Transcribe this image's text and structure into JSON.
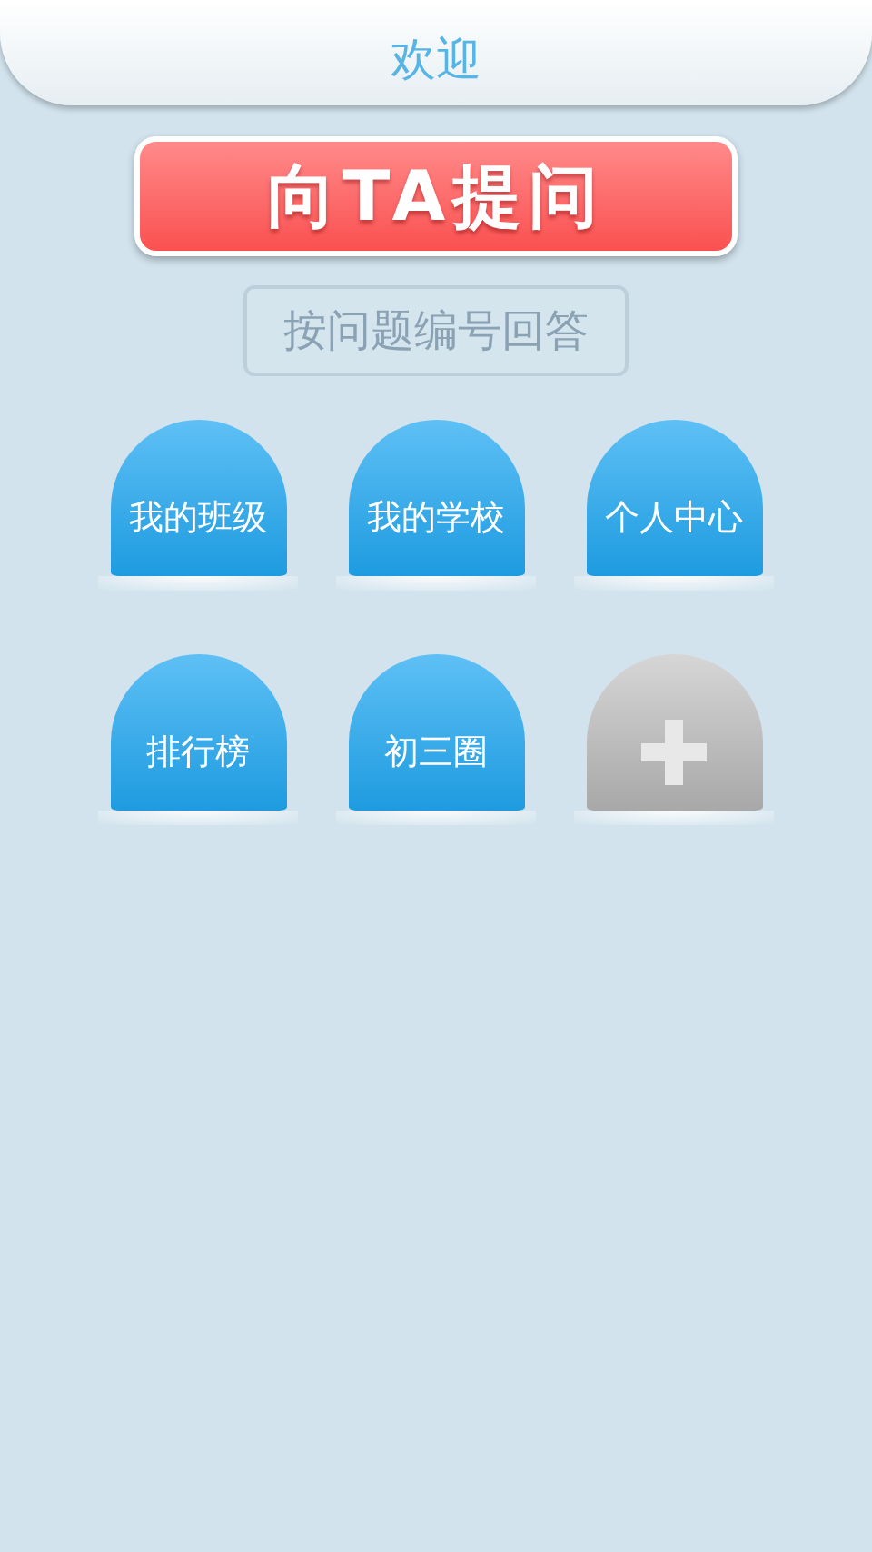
{
  "header": {
    "title": "欢迎"
  },
  "ask_button": {
    "label": "向TA提问"
  },
  "answer_button": {
    "label": "按问题编号回答"
  },
  "tiles": [
    {
      "kind": "label",
      "label": "我的班级"
    },
    {
      "kind": "label",
      "label": "我的学校"
    },
    {
      "kind": "label",
      "label": "个人中心"
    },
    {
      "kind": "label",
      "label": "排行榜"
    },
    {
      "kind": "label",
      "label": "初三圈"
    },
    {
      "kind": "add"
    }
  ]
}
